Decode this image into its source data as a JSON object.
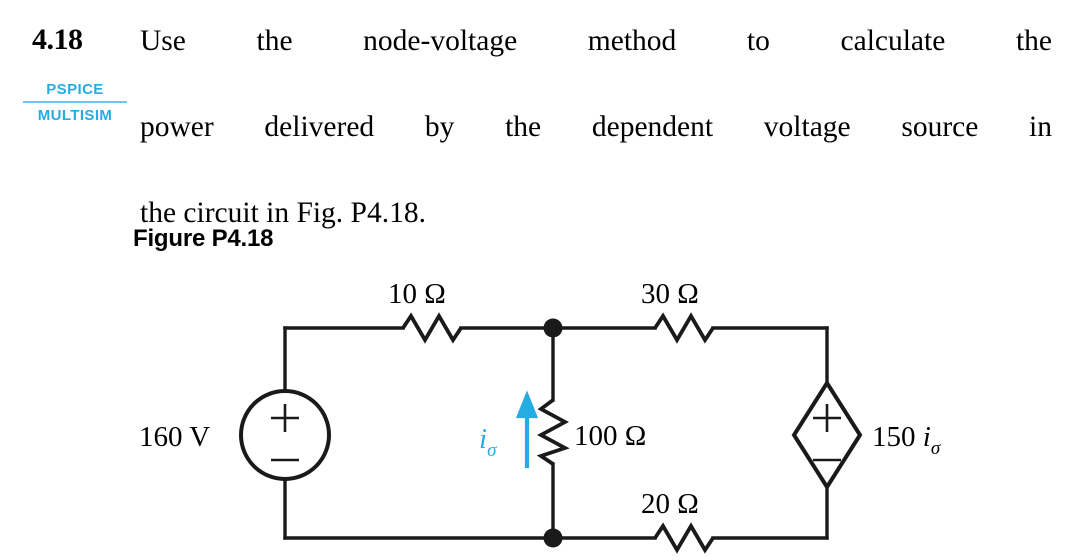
{
  "problem": {
    "number": "4.18",
    "text_line_1": "Use the node-voltage method to calculate the",
    "text_line_2": "power delivered by the dependent voltage source in",
    "text_line_3": "the circuit in Fig. P4.18.",
    "full_text": "Use the node-voltage method to calculate the power delivered by the dependent voltage source in the circuit in Fig. P4.18."
  },
  "badges": {
    "pspice": "PSPICE",
    "multisim": "MULTISIM",
    "color": "#25ACE3"
  },
  "figure": {
    "caption": "Figure P4.18",
    "accent_color": "#25ACE3",
    "wire_color": "#1a1a1a",
    "components": {
      "source_voltage": "160 V",
      "source_plus": "+",
      "source_minus": "−",
      "r_top_left": "10 Ω",
      "r_top_right": "30 Ω",
      "r_middle": "100 Ω",
      "r_bottom": "20 Ω",
      "current_label_base": "i",
      "current_label_sub": "σ",
      "dep_source_gain": "150",
      "dep_source_var_base": "i",
      "dep_source_var_sub": "σ",
      "dep_plus": "+",
      "dep_minus": "−"
    }
  }
}
